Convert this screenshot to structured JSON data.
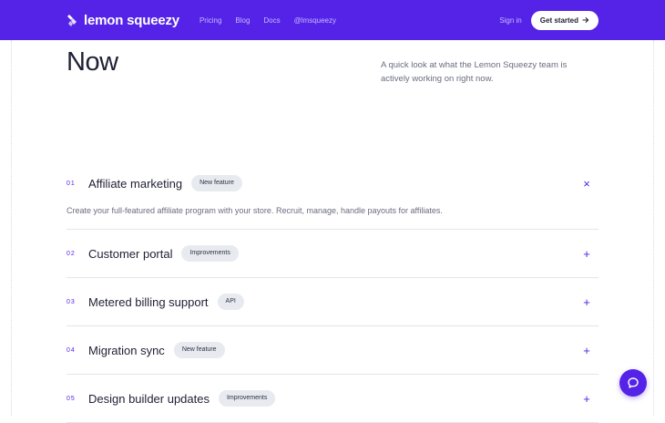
{
  "nav": {
    "logo_text": "lemon squeezy",
    "links": [
      "Pricing",
      "Blog",
      "Docs",
      "@lmsqueezy"
    ],
    "signin": "Sign in",
    "cta": "Get started",
    "cta_icon": "arrow-right-icon"
  },
  "hero": {
    "title": "Now",
    "subtitle": "A quick look at what the Lemon Squeezy team is actively working on right now."
  },
  "roadmap": {
    "items": [
      {
        "num": "01",
        "title": "Affiliate marketing",
        "badge": "New feature",
        "expanded": true,
        "toggle": "×",
        "description": "Create your full-featured affiliate program with your store. Recruit, manage, handle payouts for affiliates."
      },
      {
        "num": "02",
        "title": "Customer portal",
        "badge": "Improvements",
        "expanded": false,
        "toggle": "+"
      },
      {
        "num": "03",
        "title": "Metered billing support",
        "badge": "API",
        "expanded": false,
        "toggle": "+"
      },
      {
        "num": "04",
        "title": "Migration sync",
        "badge": "New feature",
        "expanded": false,
        "toggle": "+"
      },
      {
        "num": "05",
        "title": "Design builder updates",
        "badge": "Improvements",
        "expanded": false,
        "toggle": "+"
      }
    ]
  },
  "colors": {
    "brand": "#5423e7",
    "badge_bg": "#e7ebf0",
    "text": "#1f2033",
    "muted": "#6b6c80"
  },
  "chat": {
    "icon": "chat-bubble-icon"
  }
}
